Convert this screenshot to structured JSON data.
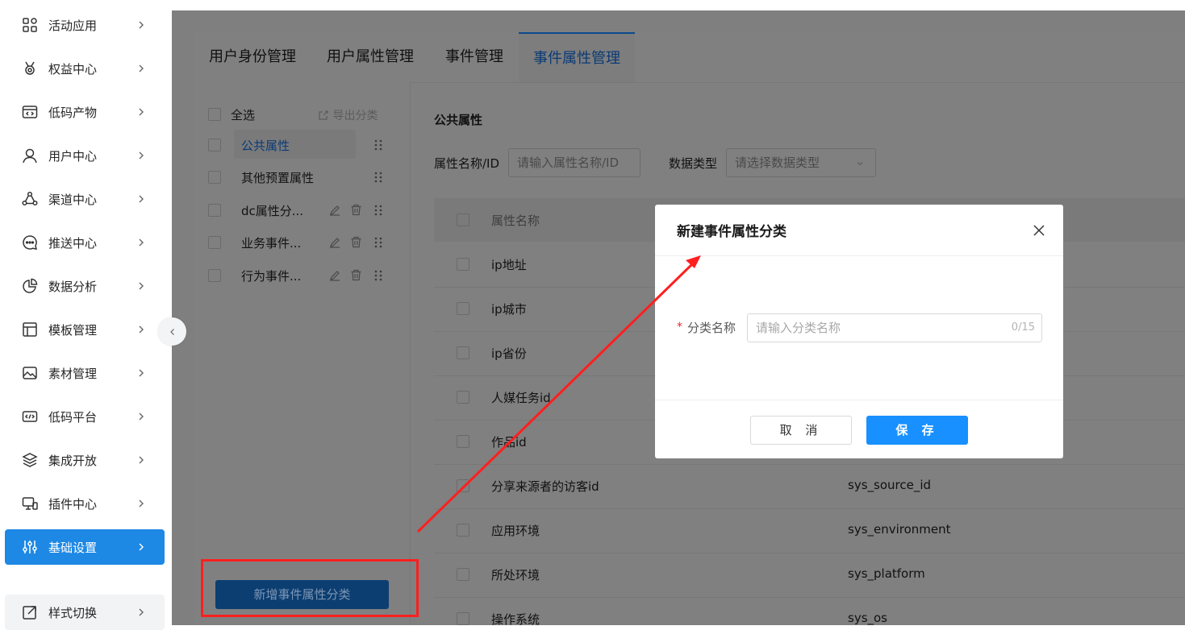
{
  "sidebar": {
    "items": [
      {
        "label": "活动应用",
        "icon": "apps-grid-icon"
      },
      {
        "label": "权益中心",
        "icon": "medal-icon"
      },
      {
        "label": "低码产物",
        "icon": "code-window-icon"
      },
      {
        "label": "用户中心",
        "icon": "user-icon"
      },
      {
        "label": "渠道中心",
        "icon": "share-nodes-icon"
      },
      {
        "label": "推送中心",
        "icon": "chat-bubble-icon"
      },
      {
        "label": "数据分析",
        "icon": "pie-chart-icon"
      },
      {
        "label": "模板管理",
        "icon": "layout-icon"
      },
      {
        "label": "素材管理",
        "icon": "image-icon"
      },
      {
        "label": "低码平台",
        "icon": "code-icon"
      },
      {
        "label": "集成开放",
        "icon": "layers-icon"
      },
      {
        "label": "插件中心",
        "icon": "monitor-icon"
      },
      {
        "label": "基础设置",
        "icon": "sliders-icon"
      },
      {
        "label": "样式切换",
        "icon": "external-link-icon"
      }
    ]
  },
  "tabs": [
    "用户身份管理",
    "用户属性管理",
    "事件管理",
    "事件属性管理"
  ],
  "left_panel": {
    "select_all": "全选",
    "export": "导出分类",
    "categories": [
      "公共属性",
      "其他预置属性",
      "dc属性分...",
      "业务事件...",
      "行为事件..."
    ],
    "add_button": "新增事件属性分类"
  },
  "main": {
    "section_title": "公共属性",
    "filter_name_label": "属性名称/ID",
    "filter_name_placeholder": "请输入属性名称/ID",
    "filter_type_label": "数据类型",
    "filter_type_placeholder": "请选择数据类型",
    "table_header": "属性名称",
    "rows": [
      {
        "name": "ip地址",
        "id": ""
      },
      {
        "name": "ip城市",
        "id": ""
      },
      {
        "name": "ip省份",
        "id": ""
      },
      {
        "name": "人媒任务id",
        "id": ""
      },
      {
        "name": "作品id",
        "id": ""
      },
      {
        "name": "分享来源者的访客id",
        "id": "sys_source_id"
      },
      {
        "name": "应用环境",
        "id": "sys_environment"
      },
      {
        "name": "所处环境",
        "id": "sys_platform"
      },
      {
        "name": "操作系统",
        "id": "sys_os"
      }
    ]
  },
  "modal": {
    "title": "新建事件属性分类",
    "required_mark": "*",
    "field_label": "分类名称",
    "field_placeholder": "请输入分类名称",
    "counter": "0/15",
    "cancel": "取 消",
    "save": "保 存"
  },
  "colors": {
    "accent": "#1890ff",
    "active_nav": "#1e88e5",
    "annotation": "#ff1f1f"
  }
}
